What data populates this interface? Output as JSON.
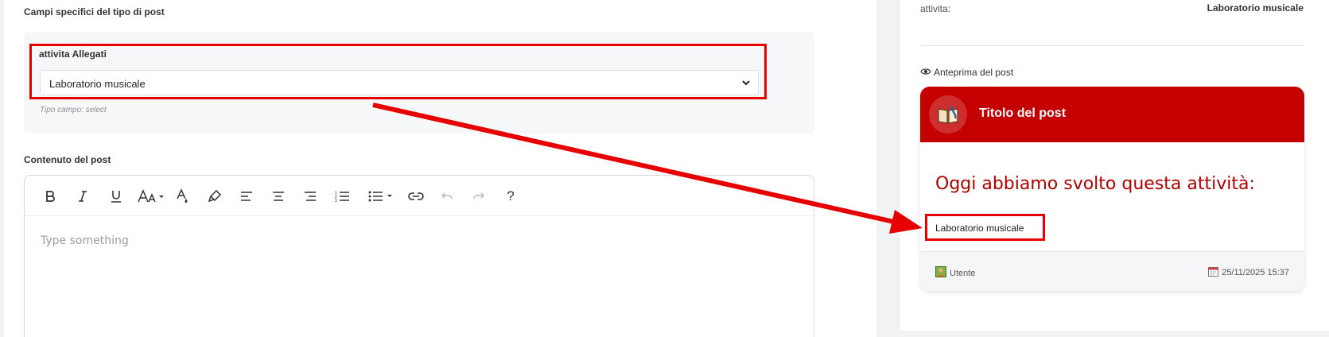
{
  "main": {
    "section_title": "Campi specifici del tipo di post",
    "field": {
      "label": "attivita Allegati",
      "selected_value": "Laboratorio musicale",
      "hint": "Tipo campo: select"
    },
    "content_title": "Contenuto del post",
    "editor": {
      "placeholder": "Type something",
      "toolbar": [
        "bold-icon",
        "italic-icon",
        "underline-icon",
        "font-size-icon",
        "text-color-icon",
        "highlight-icon",
        "align-left-icon",
        "align-center-icon",
        "align-right-icon",
        "ordered-list-icon",
        "unordered-list-icon",
        "link-icon",
        "undo-icon",
        "redo-icon",
        "help-icon"
      ],
      "help_label": "?"
    }
  },
  "side": {
    "info_label": "attivita:",
    "info_value": "Laboratorio musicale",
    "preview_label": "Anteprima del post",
    "card": {
      "title": "Titolo del post",
      "heading": "Oggi abbiamo svolto questa attività:",
      "text": "Laboratorio musicale",
      "user": "Utente",
      "date": "25/11/2025 15:37"
    }
  },
  "colors": {
    "accent": "#c50000",
    "annotation": "#e60000"
  }
}
